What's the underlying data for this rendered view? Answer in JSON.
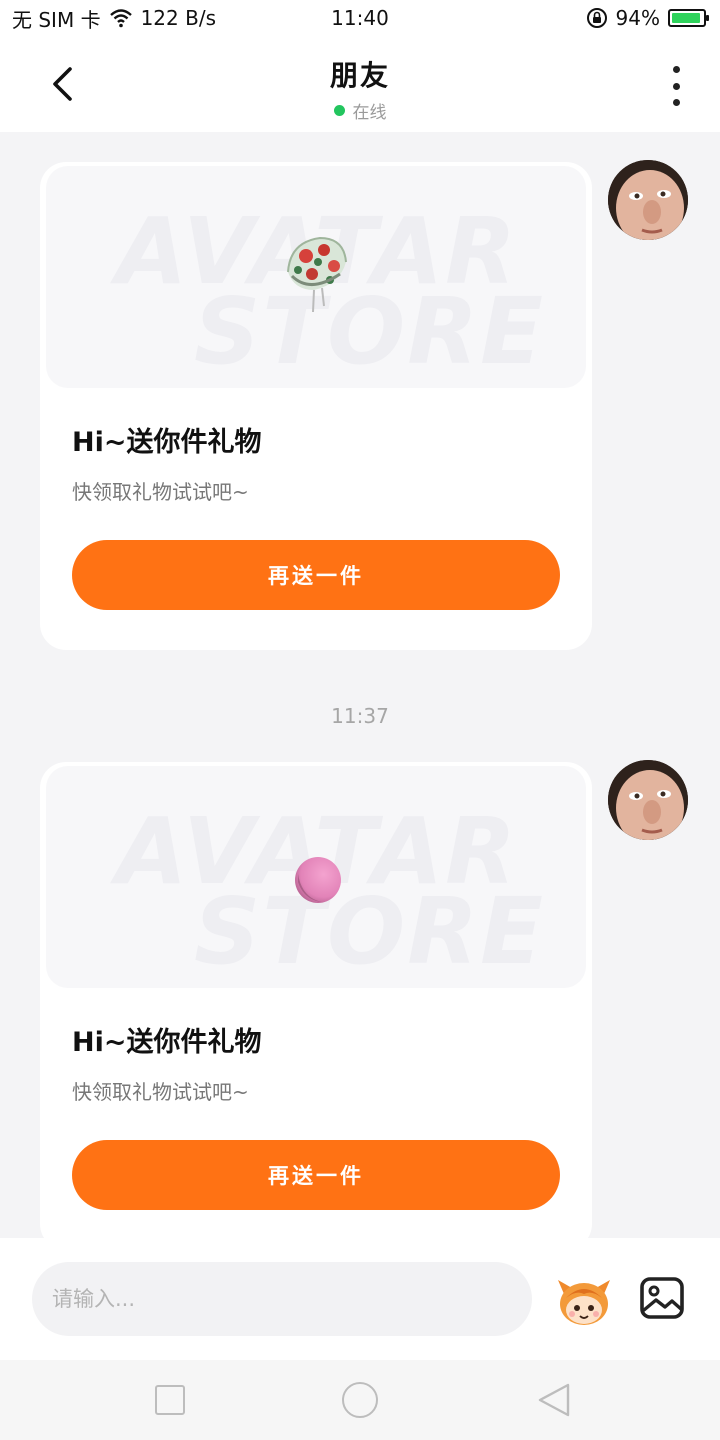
{
  "status_bar": {
    "carrier": "无 SIM 卡",
    "network_speed": "122 B/s",
    "time": "11:40",
    "battery_percent": "94%",
    "battery_level": 0.94
  },
  "header": {
    "title": "朋友",
    "status": "在线"
  },
  "messages": [
    {
      "watermark_line1": "AVATAR",
      "watermark_line2": "STORE",
      "gift_icon": "cap-icon",
      "title": "Hi~送你件礼物",
      "subtitle": "快领取礼物试试吧~",
      "button_label": "再送一件"
    },
    {
      "timestamp": "11:37",
      "watermark_line1": "AVATAR",
      "watermark_line2": "STORE",
      "gift_icon": "ball-icon",
      "title": "Hi~送你件礼物",
      "subtitle": "快领取礼物试试吧~",
      "button_label": "再送一件"
    }
  ],
  "input": {
    "placeholder": "请输入..."
  },
  "colors": {
    "accent": "#ff7214",
    "online": "#22c55e",
    "background": "#f4f4f6"
  }
}
